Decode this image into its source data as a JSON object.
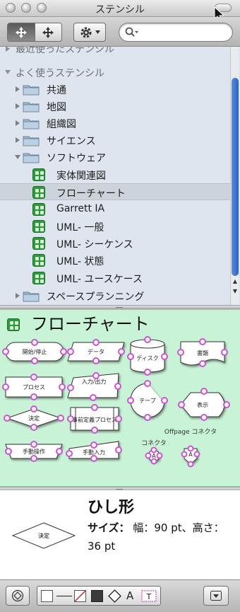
{
  "window": {
    "title": "ステンシル"
  },
  "toolbar": {
    "search": {
      "placeholder": "",
      "value": ""
    },
    "icons": [
      "move-tool-icon",
      "grid-view-icon",
      "gear-icon",
      "search-icon"
    ]
  },
  "tree": {
    "items": [
      {
        "label": "最近使ったステンシル",
        "kind": "header",
        "expanded": false
      },
      {
        "label": "よく使うステンシル",
        "kind": "header",
        "expanded": true
      },
      {
        "label": "共通",
        "kind": "folder",
        "expanded": false
      },
      {
        "label": "地図",
        "kind": "folder",
        "expanded": false
      },
      {
        "label": "組織図",
        "kind": "folder",
        "expanded": false
      },
      {
        "label": "サイエンス",
        "kind": "folder",
        "expanded": false
      },
      {
        "label": "ソフトウェア",
        "kind": "folder",
        "expanded": true
      },
      {
        "label": "実体関連図",
        "kind": "stencil"
      },
      {
        "label": "フローチャート",
        "kind": "stencil",
        "selected": true
      },
      {
        "label": "Garrett IA",
        "kind": "stencil"
      },
      {
        "label": "UML- 一般",
        "kind": "stencil"
      },
      {
        "label": "UML- シーケンス",
        "kind": "stencil"
      },
      {
        "label": "UML- 状態",
        "kind": "stencil"
      },
      {
        "label": "UML- ユースケース",
        "kind": "stencil"
      },
      {
        "label": "スペースプランニング",
        "kind": "folder",
        "expanded": false
      }
    ]
  },
  "stencil": {
    "title": "フローチャート",
    "shapes": {
      "start_end": "開始/停止",
      "data": "データ",
      "disk": "ディスク",
      "document": "書類",
      "process": "プロセス",
      "io": "入力/出力",
      "tape": "テープ",
      "display": "表示",
      "decision": "決定",
      "predefined": "事前定義プロセス",
      "manual_op": "手動操作",
      "manual_input": "手動入力",
      "connector": "コネクタ",
      "connector_letter": "A",
      "offpage": "Offpage コネクタ",
      "offpage_letter": "A"
    }
  },
  "info": {
    "preview_label": "決定",
    "name": "ひし形",
    "size_label": "サイズ：",
    "size_value": "幅：90 pt、高さ：36 pt"
  },
  "bottom": {
    "icons": [
      "shape-style-icon",
      "fill-swatch-icon",
      "line-swatch-icon",
      "no-fill-icon",
      "shadow-swatch-icon",
      "diamond-shape-icon",
      "text-style-icon",
      "text-box-icon",
      "menu-down-icon"
    ],
    "text_glyph": "A"
  },
  "colors": {
    "tree_bg": "#dfe5ee",
    "canvas_bg": "#c9f3d7",
    "connection_point": "#d050d8",
    "stencil_icon": "#2e9a3c",
    "scroll_thumb": "#2b62c4"
  }
}
